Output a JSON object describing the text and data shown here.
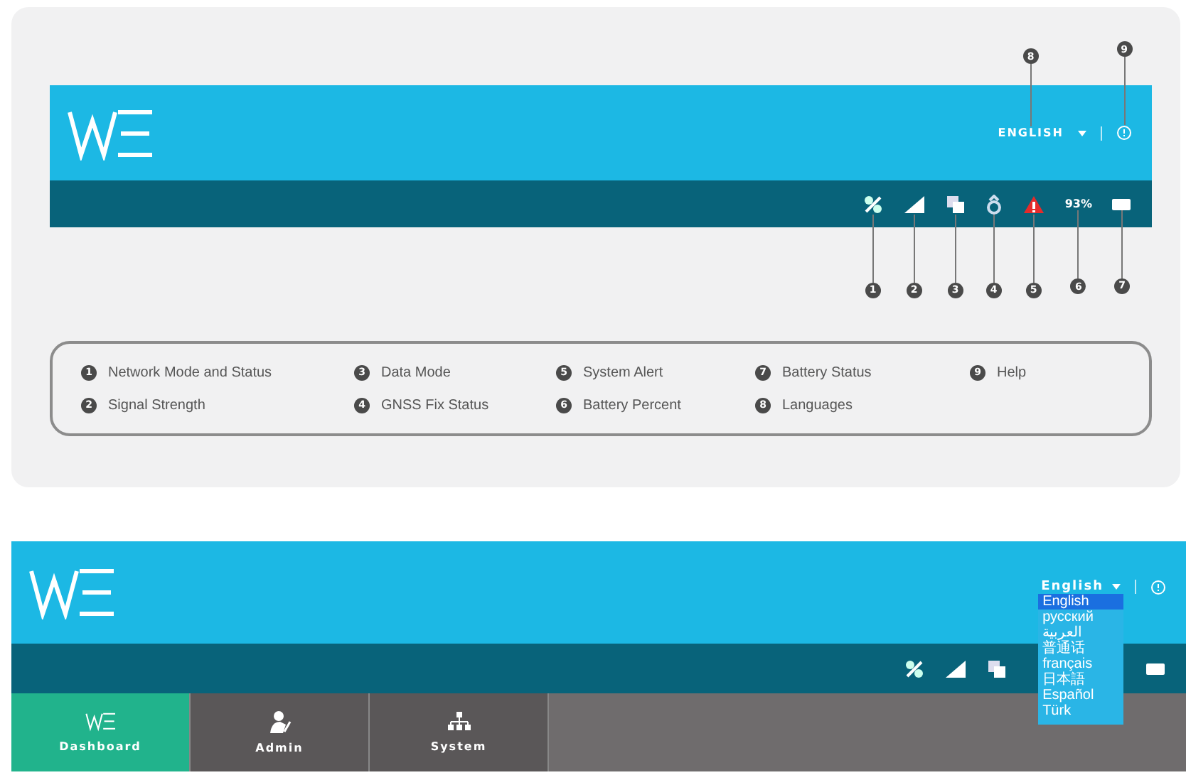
{
  "top": {
    "language": "ENGLISH",
    "header_callouts": [
      "8",
      "9"
    ],
    "battery_percent": "93%",
    "status_callouts": [
      "1",
      "2",
      "3",
      "4",
      "5",
      "6",
      "7"
    ],
    "legend": [
      {
        "number": "1",
        "label": "Network Mode and Status"
      },
      {
        "number": "3",
        "label": "Data Mode"
      },
      {
        "number": "5",
        "label": "System Alert"
      },
      {
        "number": "7",
        "label": "Battery Status"
      },
      {
        "number": "9",
        "label": "Help"
      },
      {
        "number": "2",
        "label": "Signal Strength"
      },
      {
        "number": "4",
        "label": "GNSS Fix Status"
      },
      {
        "number": "6",
        "label": "Battery Percent"
      },
      {
        "number": "8",
        "label": "Languages"
      }
    ]
  },
  "bottom": {
    "language": "English",
    "language_options": [
      {
        "label": "English",
        "selected": true
      },
      {
        "label": "русский",
        "selected": false
      },
      {
        "label": "العربية",
        "selected": false
      },
      {
        "label": "普通话",
        "selected": false
      },
      {
        "label": "français",
        "selected": false
      },
      {
        "label": "日本語",
        "selected": false
      },
      {
        "label": "Español",
        "selected": false
      },
      {
        "label": "Türk",
        "selected": false
      }
    ],
    "tabs": [
      {
        "label": "Dashboard",
        "kind": "dashboard",
        "selected": true
      },
      {
        "label": "Admin",
        "kind": "admin",
        "selected": false
      },
      {
        "label": "System",
        "kind": "system",
        "selected": false
      }
    ]
  }
}
